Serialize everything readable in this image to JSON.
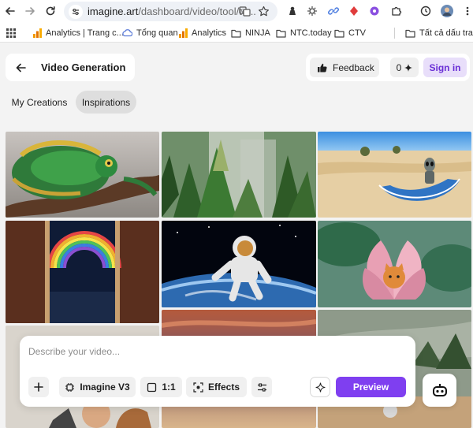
{
  "browser": {
    "url_host": "imagine.art",
    "url_path": "/dashboard/video/tool/te...",
    "bookmarks": [
      {
        "label": "Analytics | Trang c...",
        "icon": "analytics-icon"
      },
      {
        "label": "Tổng quan",
        "icon": "cloud-icon"
      },
      {
        "label": "Analytics",
        "icon": "analytics-icon"
      },
      {
        "label": "NINJA",
        "icon": "folder-icon"
      },
      {
        "label": "NTC.today",
        "icon": "folder-icon"
      },
      {
        "label": "CTV",
        "icon": "folder-icon"
      },
      {
        "label": "Tất cả dấu trang",
        "icon": "folder-icon"
      }
    ]
  },
  "header": {
    "title": "Video Generation",
    "feedback_label": "Feedback",
    "credits": "0",
    "sign_in_label": "Sign in"
  },
  "tabs": [
    {
      "label": "My Creations",
      "active": false
    },
    {
      "label": "Inspirations",
      "active": true
    }
  ],
  "gallery": [
    {
      "subject": "chameleon"
    },
    {
      "subject": "pine-forest-aerial"
    },
    {
      "subject": "alien-in-boat-on-sand"
    },
    {
      "subject": "rainbow-through-door"
    },
    {
      "subject": "astronaut-over-earth"
    },
    {
      "subject": "cat-in-lotus"
    },
    {
      "subject": "sunset-sky"
    },
    {
      "subject": "misty-landscape"
    }
  ],
  "prompt_panel": {
    "placeholder": "Describe your video...",
    "model_label": "Imagine V3",
    "ratio_label": "1:1",
    "effects_label": "Effects",
    "preview_label": "Preview"
  },
  "colors": {
    "accent": "#7f3ff0",
    "sign_in_bg": "#e8defa",
    "sign_in_text": "#6a2fd6",
    "page_bg": "#f3f3f3"
  }
}
